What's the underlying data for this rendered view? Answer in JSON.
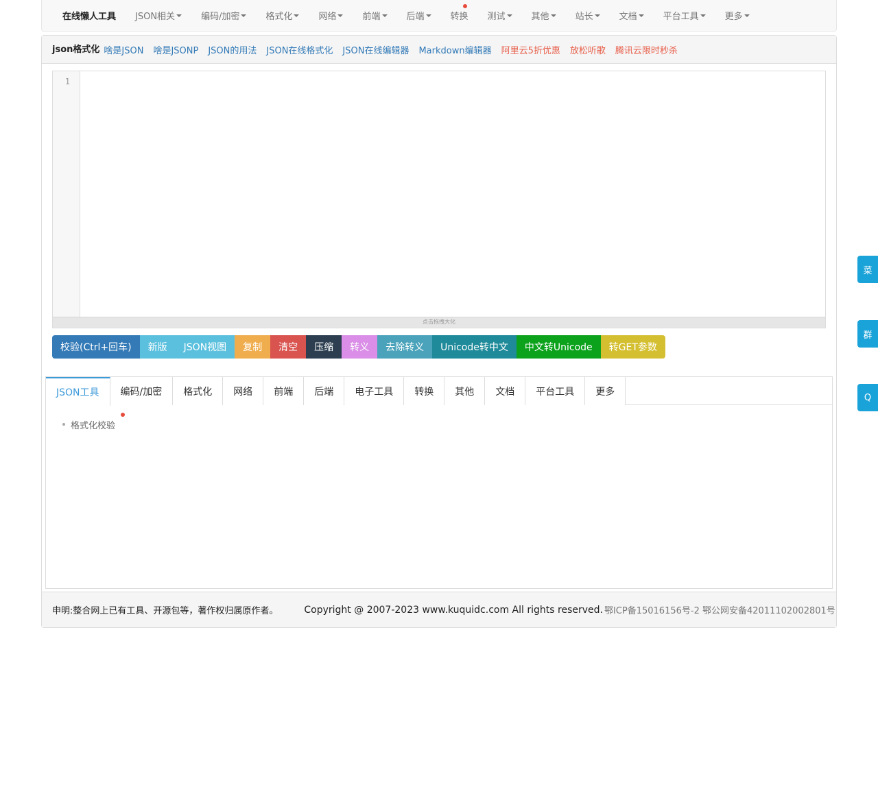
{
  "navbar": {
    "brand": "在线懒人工具",
    "items": [
      {
        "label": "JSON相关"
      },
      {
        "label": "编码/加密"
      },
      {
        "label": "格式化"
      },
      {
        "label": "网络"
      },
      {
        "label": "前端"
      },
      {
        "label": "后端"
      },
      {
        "label": "转换"
      },
      {
        "label": "测试"
      },
      {
        "label": "其他"
      },
      {
        "label": "站长"
      },
      {
        "label": "文档"
      },
      {
        "label": "平台工具"
      },
      {
        "label": "更多"
      }
    ]
  },
  "heading": {
    "title": "json格式化",
    "links": [
      "啥是JSON",
      "啥是JSONP",
      "JSON的用法",
      "JSON在线格式化",
      "JSON在线编辑器",
      "Markdown编辑器"
    ],
    "promo_links": [
      "阿里云5折优惠",
      "放松听歌",
      "腾讯云限时秒杀"
    ]
  },
  "editor": {
    "line_number": "1",
    "resize_hint": "点击拖拽大化"
  },
  "buttons": [
    {
      "label": "校验(Ctrl+回车)",
      "color": "#337ab7"
    },
    {
      "label": "新版",
      "color": "#5bc0de"
    },
    {
      "label": "JSON视图",
      "color": "#5bc0de"
    },
    {
      "label": "复制",
      "color": "#f0ad4e"
    },
    {
      "label": "清空",
      "color": "#d9534f"
    },
    {
      "label": "压缩",
      "color": "#2c3e50"
    },
    {
      "label": "转义",
      "color": "#da8ee7"
    },
    {
      "label": "去除转义",
      "color": "#4aa3bb"
    },
    {
      "label": "Unicode转中文",
      "color": "#1e8a9a"
    },
    {
      "label": "中文转Unicode",
      "color": "#0ca21c"
    },
    {
      "label": "转GET参数",
      "color": "#d4bf30"
    }
  ],
  "tabs": [
    {
      "label": "JSON工具"
    },
    {
      "label": "编码/加密"
    },
    {
      "label": "格式化"
    },
    {
      "label": "网络"
    },
    {
      "label": "前端"
    },
    {
      "label": "后端"
    },
    {
      "label": "电子工具"
    },
    {
      "label": "转换"
    },
    {
      "label": "其他"
    },
    {
      "label": "文档"
    },
    {
      "label": "平台工具"
    },
    {
      "label": "更多"
    }
  ],
  "tab_content": {
    "items": [
      "格式化校验"
    ]
  },
  "footer": {
    "statement": "申明:整合网上已有工具、开源包等，著作权归属原作者。",
    "copyright": "Copyright @ 2007-2023 www.kuquidc.com All rights reserved.",
    "icp": "鄂ICP备15016156号-2 鄂公网安备42011102002801号"
  },
  "side_buttons": [
    "菜",
    "群",
    "Q"
  ],
  "colors": {
    "accent": "#3c9ad9",
    "link": "#337ab7",
    "promo": "#e8604c",
    "side": "#1aa3d9"
  }
}
